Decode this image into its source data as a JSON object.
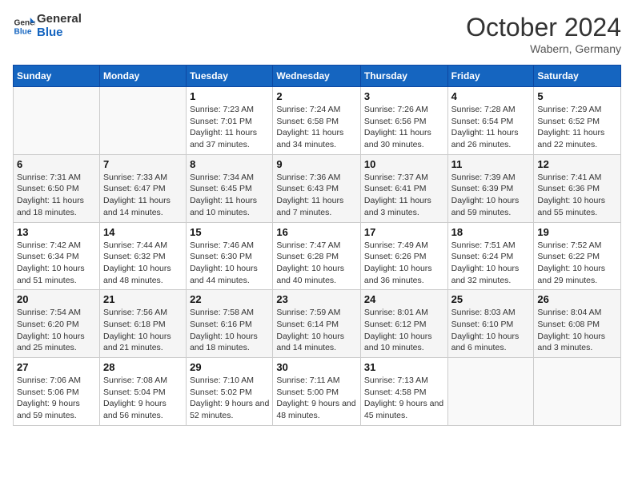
{
  "header": {
    "logo_line1": "General",
    "logo_line2": "Blue",
    "month": "October 2024",
    "location": "Wabern, Germany"
  },
  "weekdays": [
    "Sunday",
    "Monday",
    "Tuesday",
    "Wednesday",
    "Thursday",
    "Friday",
    "Saturday"
  ],
  "weeks": [
    [
      {
        "day": "",
        "info": ""
      },
      {
        "day": "",
        "info": ""
      },
      {
        "day": "1",
        "info": "Sunrise: 7:23 AM\nSunset: 7:01 PM\nDaylight: 11 hours and 37 minutes."
      },
      {
        "day": "2",
        "info": "Sunrise: 7:24 AM\nSunset: 6:58 PM\nDaylight: 11 hours and 34 minutes."
      },
      {
        "day": "3",
        "info": "Sunrise: 7:26 AM\nSunset: 6:56 PM\nDaylight: 11 hours and 30 minutes."
      },
      {
        "day": "4",
        "info": "Sunrise: 7:28 AM\nSunset: 6:54 PM\nDaylight: 11 hours and 26 minutes."
      },
      {
        "day": "5",
        "info": "Sunrise: 7:29 AM\nSunset: 6:52 PM\nDaylight: 11 hours and 22 minutes."
      }
    ],
    [
      {
        "day": "6",
        "info": "Sunrise: 7:31 AM\nSunset: 6:50 PM\nDaylight: 11 hours and 18 minutes."
      },
      {
        "day": "7",
        "info": "Sunrise: 7:33 AM\nSunset: 6:47 PM\nDaylight: 11 hours and 14 minutes."
      },
      {
        "day": "8",
        "info": "Sunrise: 7:34 AM\nSunset: 6:45 PM\nDaylight: 11 hours and 10 minutes."
      },
      {
        "day": "9",
        "info": "Sunrise: 7:36 AM\nSunset: 6:43 PM\nDaylight: 11 hours and 7 minutes."
      },
      {
        "day": "10",
        "info": "Sunrise: 7:37 AM\nSunset: 6:41 PM\nDaylight: 11 hours and 3 minutes."
      },
      {
        "day": "11",
        "info": "Sunrise: 7:39 AM\nSunset: 6:39 PM\nDaylight: 10 hours and 59 minutes."
      },
      {
        "day": "12",
        "info": "Sunrise: 7:41 AM\nSunset: 6:36 PM\nDaylight: 10 hours and 55 minutes."
      }
    ],
    [
      {
        "day": "13",
        "info": "Sunrise: 7:42 AM\nSunset: 6:34 PM\nDaylight: 10 hours and 51 minutes."
      },
      {
        "day": "14",
        "info": "Sunrise: 7:44 AM\nSunset: 6:32 PM\nDaylight: 10 hours and 48 minutes."
      },
      {
        "day": "15",
        "info": "Sunrise: 7:46 AM\nSunset: 6:30 PM\nDaylight: 10 hours and 44 minutes."
      },
      {
        "day": "16",
        "info": "Sunrise: 7:47 AM\nSunset: 6:28 PM\nDaylight: 10 hours and 40 minutes."
      },
      {
        "day": "17",
        "info": "Sunrise: 7:49 AM\nSunset: 6:26 PM\nDaylight: 10 hours and 36 minutes."
      },
      {
        "day": "18",
        "info": "Sunrise: 7:51 AM\nSunset: 6:24 PM\nDaylight: 10 hours and 32 minutes."
      },
      {
        "day": "19",
        "info": "Sunrise: 7:52 AM\nSunset: 6:22 PM\nDaylight: 10 hours and 29 minutes."
      }
    ],
    [
      {
        "day": "20",
        "info": "Sunrise: 7:54 AM\nSunset: 6:20 PM\nDaylight: 10 hours and 25 minutes."
      },
      {
        "day": "21",
        "info": "Sunrise: 7:56 AM\nSunset: 6:18 PM\nDaylight: 10 hours and 21 minutes."
      },
      {
        "day": "22",
        "info": "Sunrise: 7:58 AM\nSunset: 6:16 PM\nDaylight: 10 hours and 18 minutes."
      },
      {
        "day": "23",
        "info": "Sunrise: 7:59 AM\nSunset: 6:14 PM\nDaylight: 10 hours and 14 minutes."
      },
      {
        "day": "24",
        "info": "Sunrise: 8:01 AM\nSunset: 6:12 PM\nDaylight: 10 hours and 10 minutes."
      },
      {
        "day": "25",
        "info": "Sunrise: 8:03 AM\nSunset: 6:10 PM\nDaylight: 10 hours and 6 minutes."
      },
      {
        "day": "26",
        "info": "Sunrise: 8:04 AM\nSunset: 6:08 PM\nDaylight: 10 hours and 3 minutes."
      }
    ],
    [
      {
        "day": "27",
        "info": "Sunrise: 7:06 AM\nSunset: 5:06 PM\nDaylight: 9 hours and 59 minutes."
      },
      {
        "day": "28",
        "info": "Sunrise: 7:08 AM\nSunset: 5:04 PM\nDaylight: 9 hours and 56 minutes."
      },
      {
        "day": "29",
        "info": "Sunrise: 7:10 AM\nSunset: 5:02 PM\nDaylight: 9 hours and 52 minutes."
      },
      {
        "day": "30",
        "info": "Sunrise: 7:11 AM\nSunset: 5:00 PM\nDaylight: 9 hours and 48 minutes."
      },
      {
        "day": "31",
        "info": "Sunrise: 7:13 AM\nSunset: 4:58 PM\nDaylight: 9 hours and 45 minutes."
      },
      {
        "day": "",
        "info": ""
      },
      {
        "day": "",
        "info": ""
      }
    ]
  ]
}
